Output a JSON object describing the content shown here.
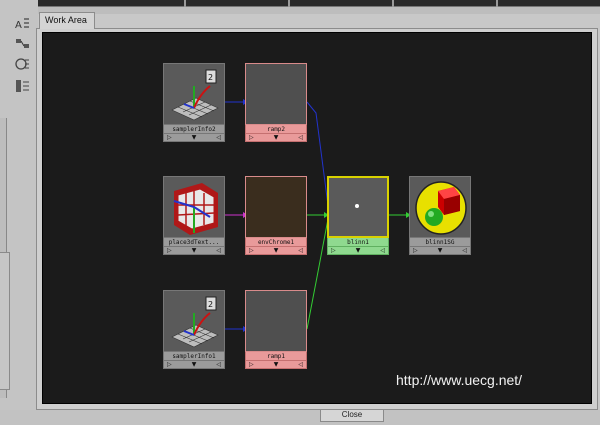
{
  "tab": {
    "label": "Work Area"
  },
  "footer": {
    "close_label": "Close"
  },
  "watermark": {
    "text": "http://www.uecg.net/"
  },
  "toolbar": {
    "tools": [
      "align-icon",
      "rearrange-icon",
      "info-icon",
      "list-icon"
    ]
  },
  "nodes": {
    "samplerInfo2": {
      "label": "samplerInfo2"
    },
    "ramp2": {
      "label": "ramp2"
    },
    "place3d": {
      "label": "place3dText..."
    },
    "envChrome1": {
      "label": "envChrome1"
    },
    "blinn1": {
      "label": "blinn1"
    },
    "blinn1SG": {
      "label": "blinn1SG"
    },
    "samplerInfo1": {
      "label": "samplerInfo1"
    },
    "ramp1": {
      "label": "ramp1"
    }
  },
  "port_glyphs": {
    "left": "▷",
    "mid": "▼",
    "right": "◁"
  },
  "colors": {
    "background": "#1b1b1b",
    "texture_label": "#e99a9a",
    "material_label": "#8fd98f",
    "wire_blue": "#2233cc",
    "wire_magenta": "#cc33cc",
    "wire_green": "#33cc33"
  }
}
